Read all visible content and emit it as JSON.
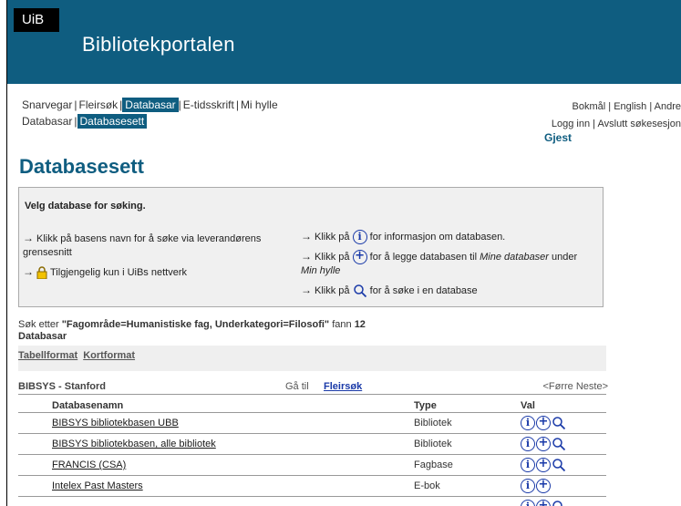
{
  "banner": {
    "logo_text": "UiB",
    "title": "Bibliotekportalen"
  },
  "nav": {
    "primary": [
      {
        "label": "Snarvegar",
        "active": false
      },
      {
        "label": "Fleirsøk",
        "active": false
      },
      {
        "label": "Databasar",
        "active": true
      },
      {
        "label": "E-tidsskrift",
        "active": false
      },
      {
        "label": "Mi hylle",
        "active": false
      }
    ],
    "secondary": [
      {
        "label": "Databasar",
        "active": false
      },
      {
        "label": "Databasesett",
        "active": true
      }
    ]
  },
  "lang": {
    "bokmal": "Bokmål",
    "english": "English",
    "andre": "Andre"
  },
  "account": {
    "login": "Logg inn",
    "end": "Avslutt søkesesjon",
    "user": "Gjest"
  },
  "page": {
    "title": "Databasesett"
  },
  "info": {
    "heading": "Velg database for søking.",
    "left1": "Klikk på basens navn for å søke via leverandørens grensesnitt",
    "left2": "Tilgjengelig kun i UiBs nettverk",
    "right1_a": "Klikk på",
    "right1_b": "for informasjon om databasen.",
    "right2_a": "Klikk på",
    "right2_b": "for å legge databasen til",
    "right2_c": "Mine databaser",
    "right2_d": "under",
    "right2_e": "Min hylle",
    "right3_a": "Klikk på",
    "right3_b": "for å søke i en database"
  },
  "result": {
    "prefix": "Søk etter",
    "query": "\"Fagområde=Humanistiske fag, Underkategori=Filosofi\"",
    "fann": "fann",
    "count": "12",
    "unit": "Databasar"
  },
  "format": {
    "table": "Tabellformat",
    "short": "Kortformat"
  },
  "group": {
    "name": "BIBSYS - Stanford",
    "goto": "Gå til",
    "goto_link": "Fleirsøk",
    "pager": "<Førre Neste>"
  },
  "table": {
    "headers": {
      "name": "Databasenamn",
      "type": "Type",
      "val": "Val"
    },
    "rows": [
      {
        "name": "BIBSYS bibliotekbasen UBB",
        "type": "Bibliotek",
        "icons": [
          "info",
          "add",
          "search"
        ]
      },
      {
        "name": "BIBSYS bibliotekbasen, alle bibliotek",
        "type": "Bibliotek",
        "icons": [
          "info",
          "add",
          "search"
        ]
      },
      {
        "name": "FRANCIS (CSA)",
        "type": "Fagbase",
        "icons": [
          "info",
          "add",
          "search"
        ]
      },
      {
        "name": "Intelex Past Masters",
        "type": "E-bok",
        "icons": [
          "info",
          "add"
        ]
      },
      {
        "name": "",
        "type": "",
        "icons": [
          "info",
          "add",
          "search"
        ]
      }
    ]
  },
  "colors": {
    "brand": "#0f5d80",
    "link": "#1a3aa8"
  }
}
